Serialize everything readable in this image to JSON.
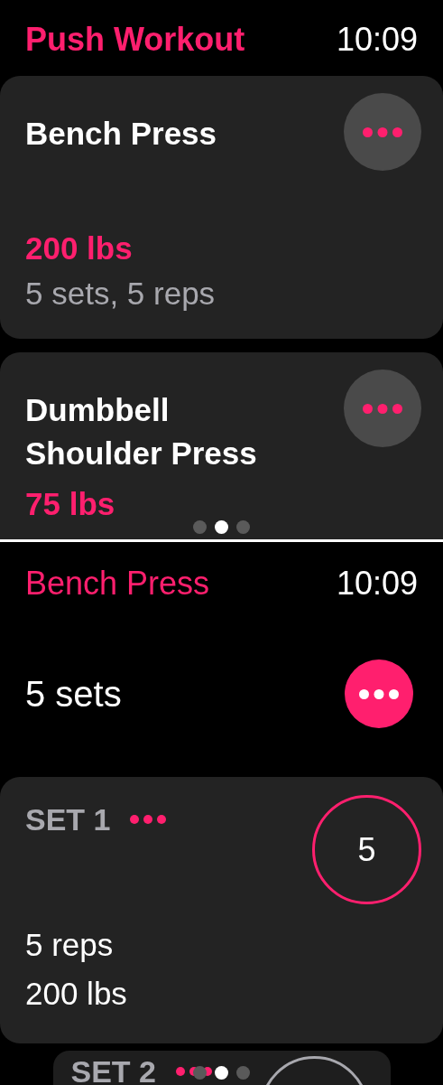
{
  "workout_screen": {
    "title": "Push Workout",
    "time": "10:09",
    "exercises": [
      {
        "name": "Bench Press",
        "weight": "200 lbs",
        "detail": "5 sets, 5 reps"
      },
      {
        "name": "Dumbbell Shoulder Press",
        "weight": "75 lbs"
      }
    ],
    "pages": [
      {
        "selected": false
      },
      {
        "selected": true
      },
      {
        "selected": false
      }
    ]
  },
  "exercise_screen": {
    "title": "Bench Press",
    "time": "10:09",
    "summary": "5 sets",
    "sets": [
      {
        "label": "SET 1",
        "count": "5",
        "reps": "5 reps",
        "weight": "200 lbs",
        "active": true
      },
      {
        "label": "SET 2",
        "active": false
      }
    ],
    "pages": [
      {
        "selected": false
      },
      {
        "selected": true
      },
      {
        "selected": false
      }
    ]
  }
}
